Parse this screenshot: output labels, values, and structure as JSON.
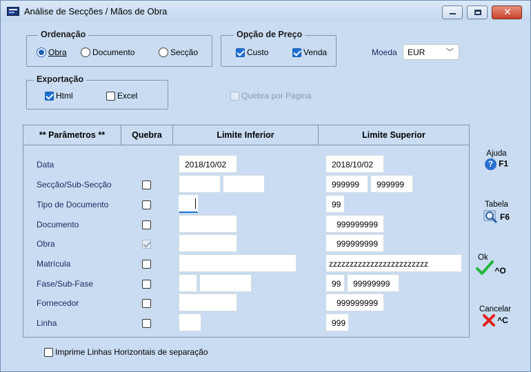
{
  "window": {
    "title": "Análise de Secções /  Mãos de Obra"
  },
  "ordenacao": {
    "legend": "Ordenação",
    "options": [
      {
        "label": "Obra",
        "selected": true
      },
      {
        "label": "Documento",
        "selected": false
      },
      {
        "label": "Secção",
        "selected": false
      }
    ]
  },
  "opcao_preco": {
    "legend": "Opção de Preço",
    "options": [
      {
        "label": "Custo",
        "checked": true
      },
      {
        "label": "Venda",
        "checked": true
      }
    ]
  },
  "moeda": {
    "label": "Moeda",
    "value": "EUR"
  },
  "exportacao": {
    "legend": "Exportação",
    "options": [
      {
        "label": "Html",
        "checked": true
      },
      {
        "label": "Excel",
        "checked": false
      }
    ]
  },
  "quebra_pagina": {
    "label": "Quebra por Página",
    "checked": false,
    "enabled": false
  },
  "grid": {
    "headers": {
      "parametros": "**  Parâmetros  **",
      "quebra": "Quebra",
      "inferior": "Limite Inferior",
      "superior": "Limite Superior"
    },
    "rows": [
      {
        "label": "Data",
        "inf": [
          "2018/10/02"
        ],
        "sup": [
          "2018/10/02"
        ],
        "has_break": false
      },
      {
        "label": "Secção/Sub-Secção",
        "inf": [
          "",
          ""
        ],
        "sup": [
          "999999",
          "999999"
        ],
        "break": false
      },
      {
        "label": "Tipo de Documento",
        "inf": [
          ""
        ],
        "sup": [
          "99"
        ],
        "break": false
      },
      {
        "label": "Documento",
        "inf": [
          ""
        ],
        "sup": [
          "999999999"
        ],
        "break": false
      },
      {
        "label": "Obra",
        "inf": [
          ""
        ],
        "sup": [
          "999999999"
        ],
        "break": true,
        "break_disabled": true
      },
      {
        "label": "Matrícula",
        "inf": [
          ""
        ],
        "sup": [
          "zzzzzzzzzzzzzzzzzzzzzzzz"
        ],
        "break": false
      },
      {
        "label": "Fase/Sub-Fase",
        "inf": [
          "",
          ""
        ],
        "sup": [
          "99",
          "99999999"
        ],
        "break": false
      },
      {
        "label": "Fornecedor",
        "inf": [
          ""
        ],
        "sup": [
          "999999999"
        ],
        "break": false
      },
      {
        "label": "Linha",
        "inf": [
          ""
        ],
        "sup": [
          "999"
        ],
        "break": false
      }
    ]
  },
  "imprime_linhas": {
    "label": "Imprime Linhas Horizontais de separação",
    "checked": false
  },
  "actions": {
    "ajuda": {
      "label": "Ajuda",
      "key": "F1",
      "icon": "help-icon"
    },
    "tabela": {
      "label": "Tabela",
      "key": "F6",
      "icon": "magnifier-icon"
    },
    "ok": {
      "label": "Ok",
      "key": "^O",
      "icon": "checkmark-icon"
    },
    "cancelar": {
      "label": "Cancelar",
      "key": "^C",
      "icon": "red-x-icon"
    }
  }
}
